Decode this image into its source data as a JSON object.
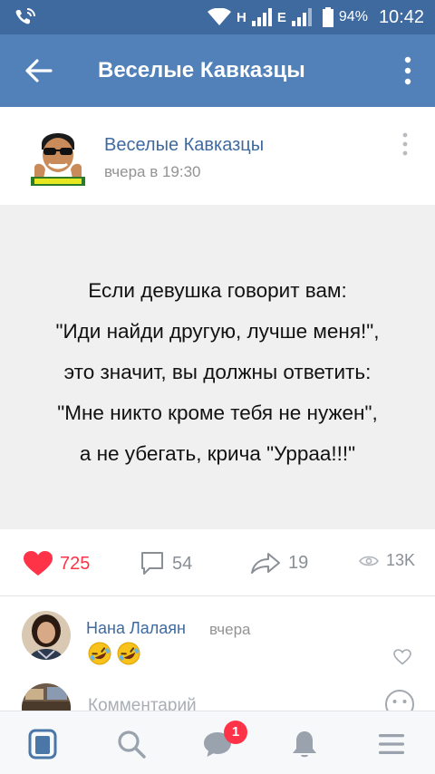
{
  "status_bar": {
    "network_h": "H",
    "network_e": "E",
    "battery_percent": "94%",
    "time": "10:42"
  },
  "app_bar": {
    "title": "Веселые Кавказцы"
  },
  "post": {
    "author": "Веселые Кавказцы",
    "posted_at": "вчера в 19:30",
    "quote_lines": [
      "Если девушка говорит вам:",
      "\"Иди найди другую, лучше меня!\",",
      "это значит, вы должны ответить:",
      "\"Мне никто кроме тебя не нужен\",",
      "а не убегать, крича \"Урраа!!!\""
    ],
    "stats": {
      "likes": "725",
      "comments": "54",
      "shares": "19",
      "views": "13K"
    }
  },
  "comment": {
    "author": "Нана Лалаян",
    "when": "вчера",
    "emoji": [
      "rofl-emoji",
      "rofl-emoji"
    ]
  },
  "composer": {
    "placeholder": "Комментарий"
  },
  "tab_bar": {
    "messages_badge": "1"
  },
  "colors": {
    "status_bar": "#3e6aa0",
    "app_bar": "#5181b8",
    "link_blue": "#3e6aa0",
    "like_red": "#ff3347",
    "icon_gray": "#8a8f96",
    "active_tab": "#4a76a8"
  }
}
